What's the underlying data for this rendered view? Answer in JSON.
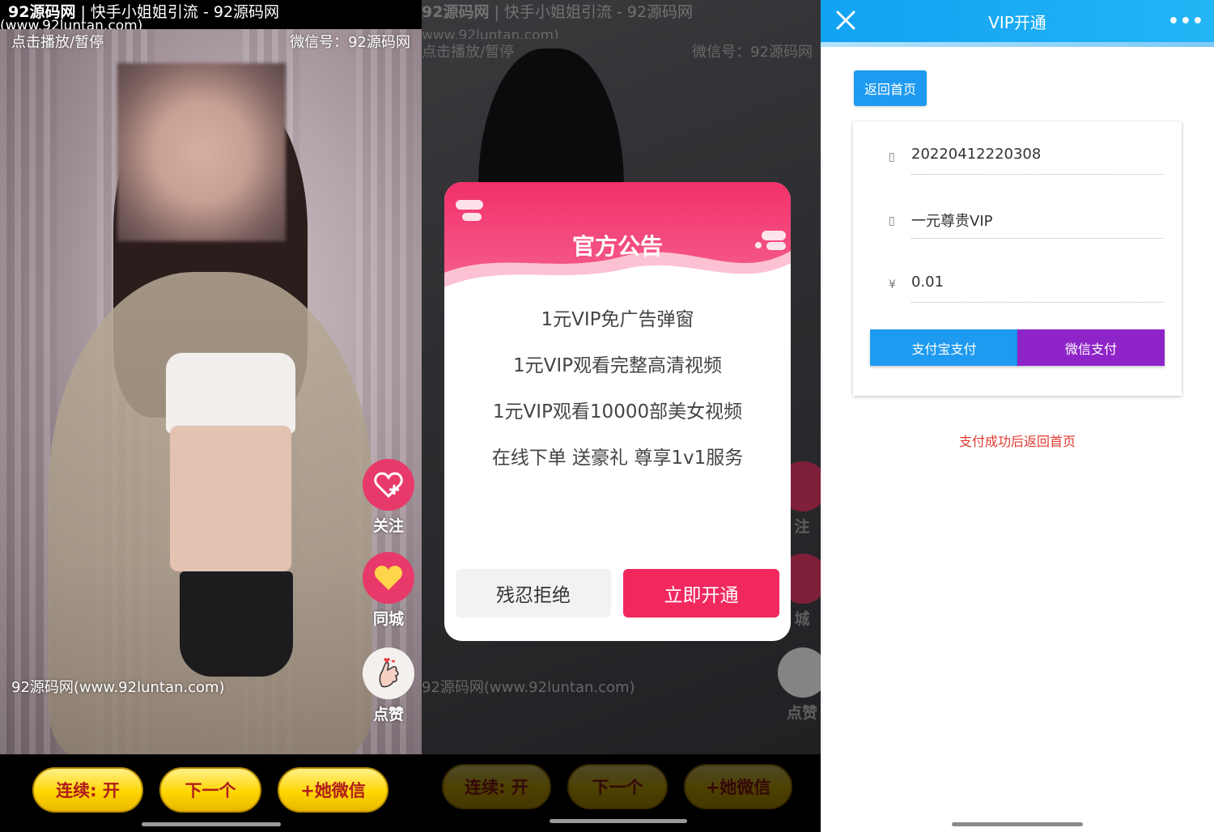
{
  "panel1": {
    "watermark_title_bold": "92源码网",
    "watermark_title_rest": " | 快手小姐姐引流 - 92源码网",
    "watermark_url": "(www.92luntan.com)",
    "play_pause": "点击播放/暂停",
    "wechat_id": "微信号：92源码网",
    "site": "92源码网(www.92luntan.com)",
    "side_buttons": [
      {
        "label": "关注",
        "icon": "heart-plus-icon"
      },
      {
        "label": "同城",
        "icon": "heart-icon"
      },
      {
        "label": "点赞",
        "icon": "finger-heart-icon"
      }
    ],
    "bottom_buttons": [
      "连续: 开",
      "下一个",
      "+她微信"
    ]
  },
  "panel2": {
    "watermark_title_bold": "92源码网",
    "watermark_title_rest": " | 快手小姐姐引流 - 92源码网",
    "watermark_url": "www.92luntan.com)",
    "play_pause": "点击播放/暂停",
    "wechat_id": "微信号：92源码网",
    "site": "92源码网(www.92luntan.com)",
    "side_labels": [
      "注",
      "城",
      "点赞"
    ],
    "bottom_buttons": [
      "连续: 开",
      "下一个",
      "+她微信"
    ],
    "modal": {
      "title": "官方公告",
      "lines": [
        "1元VIP免广告弹窗",
        "1元VIP观看完整高清视频",
        "1元VIP观看10000部美女视频",
        "在线下单 送豪礼 尊享1v1服务"
      ],
      "reject_label": "残忍拒绝",
      "open_label": "立即开通",
      "accent": "#f0285e"
    }
  },
  "panel3": {
    "title": "VIP开通",
    "more": "•••",
    "home_button": "返回首页",
    "order_icon": "▯",
    "order_no": "20220412220308",
    "product_icon": "▯",
    "product": "一元尊贵VIP",
    "price_icon": "¥",
    "price": "0.01",
    "alipay_label": "支付宝支付",
    "wechat_pay_label": "微信支付",
    "note": "支付成功后返回首页",
    "header_color": "#12a2f2"
  }
}
